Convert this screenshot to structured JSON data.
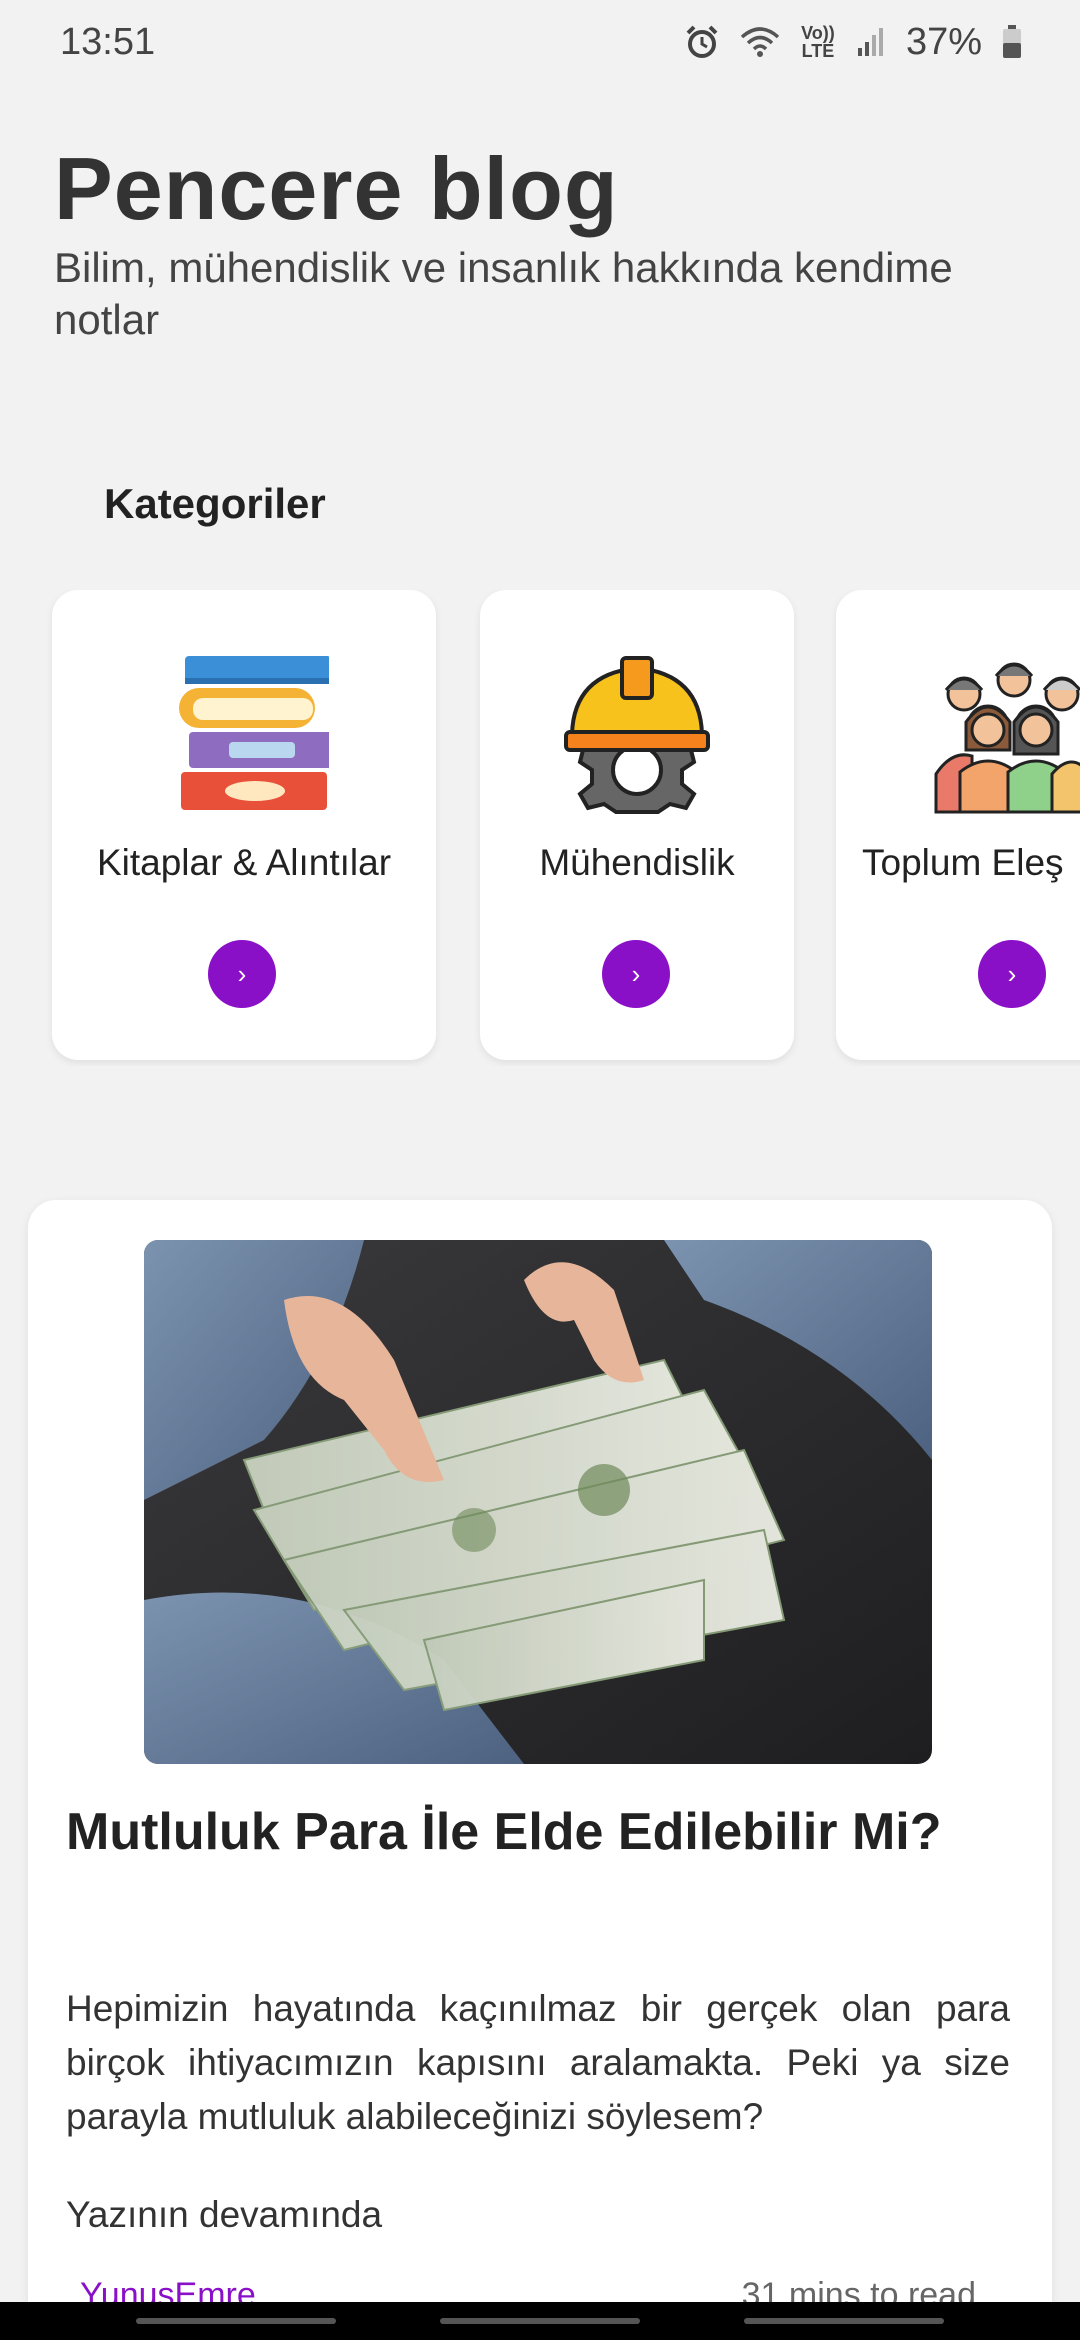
{
  "status_bar": {
    "time": "13:51",
    "battery": "37%",
    "volte": "Vo)) LTE",
    "icons": [
      "alarm-icon",
      "wifi-icon",
      "volte-icon",
      "signal-icon",
      "battery-icon"
    ]
  },
  "header": {
    "title": "Pencere blog",
    "subtitle": "Bilim, mühendislik ve insanlık hakkında kendime notlar"
  },
  "categories": {
    "heading": "Kategoriler",
    "items": [
      {
        "label": "Kitaplar & Alıntılar",
        "icon": "books-icon",
        "button": "›"
      },
      {
        "label": "Mühendislik",
        "icon": "engineer-helmet-gear-icon",
        "button": "›"
      },
      {
        "label": "Toplum Eleş",
        "icon": "community-people-icon",
        "button": "›"
      }
    ]
  },
  "post": {
    "image": "hands-holding-money-image",
    "title": "Mutluluk Para İle Elde Edilebilir Mi?",
    "excerpt": "Hepimizin hayatında kaçınılmaz bir gerçek olan para birçok ihtiyacımızın kapısını aralamakta. Peki ya size parayla mutluluk alabileceğinizi söylesem?",
    "read_more": "Yazının devamında",
    "author": "YunusEmre",
    "read_time": "31 mins to read"
  },
  "colors": {
    "accent": "#8a10c8",
    "background": "#f2f2f2",
    "card": "#ffffff",
    "text": "#333333"
  }
}
